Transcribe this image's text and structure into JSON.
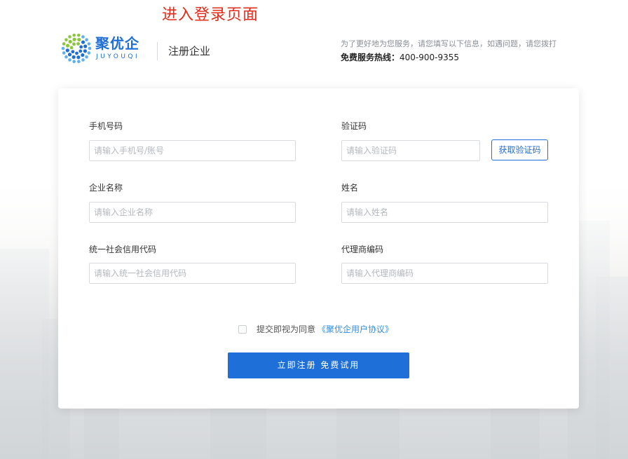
{
  "overlay": {
    "caption": "进入登录页面"
  },
  "header": {
    "logo_cn": "聚优企",
    "logo_en": "JUYOUQI",
    "page_title": "注册企业",
    "info_text": "为了更好地为您服务，请您填写以下信息，如遇问题，请您拨打",
    "hotline_label": "免费服务热线：",
    "hotline_number": "400-900-9355"
  },
  "form": {
    "phone": {
      "label": "手机号码",
      "placeholder": "请输入手机号/账号",
      "value": ""
    },
    "code": {
      "label": "验证码",
      "placeholder": "请输入验证码",
      "value": "",
      "button_label": "获取验证码"
    },
    "company": {
      "label": "企业名称",
      "placeholder": "请输入企业名称",
      "value": ""
    },
    "name": {
      "label": "姓名",
      "placeholder": "请输入姓名",
      "value": ""
    },
    "credit_code": {
      "label": "统一社会信用代码",
      "placeholder": "请输入统一社会信用代码",
      "value": ""
    },
    "agent_code": {
      "label": "代理商编码",
      "placeholder": "请输入代理商编码",
      "value": ""
    },
    "agreement": {
      "checked": false,
      "text": "提交即视为同意",
      "link_text": "《聚优企用户协议》"
    },
    "submit_label": "立即注册 免费试用"
  },
  "colors": {
    "brand_blue": "#1f6fd8",
    "link_blue": "#2b8fe8",
    "overlay_red": "#e42b1a",
    "logo_green": "#8cc63f",
    "logo_blue": "#1d6fd6"
  },
  "icons": {
    "logo": "juyouqi-dotted-ring-logo"
  }
}
